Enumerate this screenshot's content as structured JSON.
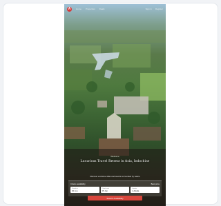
{
  "nav": {
    "logo_glyph": "A",
    "links": [
      "Home",
      "Properties",
      "Deals"
    ],
    "right": [
      "Sign in",
      "Register"
    ]
  },
  "hero": {
    "kicker": "Welcome",
    "headline": "Luxurious Travel Retreat in Asia, Indochine",
    "subline": "Discover exclusive villas and resorts surrounded by nature"
  },
  "booking": {
    "title": "Check availability",
    "right_label": "Best price",
    "fields": [
      {
        "label": "Check-in",
        "value": "02 Jun"
      },
      {
        "label": "Check-out",
        "value": "05 Jun"
      },
      {
        "label": "Guests",
        "value": "2 Adults"
      }
    ],
    "search_label": "Search Availability"
  },
  "colors": {
    "accent": "#d8463c"
  }
}
